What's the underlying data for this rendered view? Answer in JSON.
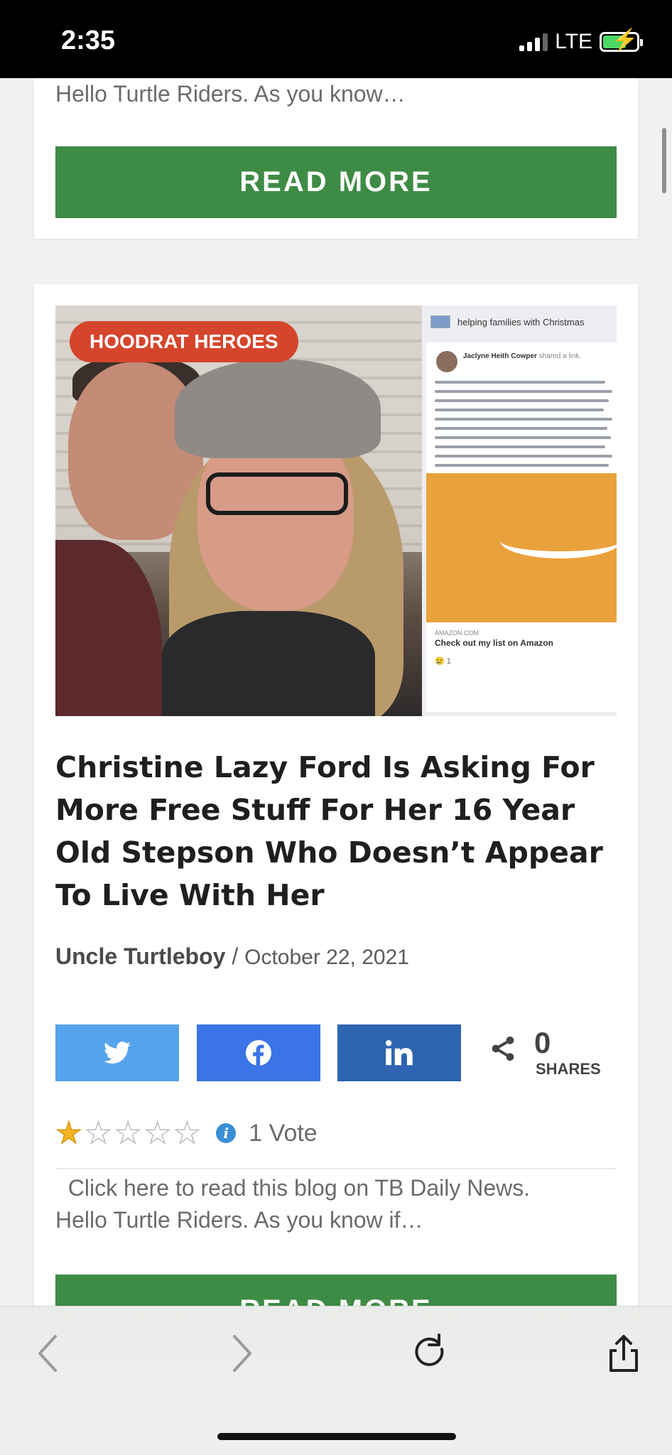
{
  "status_bar": {
    "time": "2:35",
    "network": "LTE"
  },
  "previous_card": {
    "excerpt": "Hello Turtle Riders. As you know…",
    "read_more_label": "READ MORE"
  },
  "article": {
    "category": "HOODRAT HEROES",
    "title": "Christine Lazy Ford Is Asking For More Free Stuff For Her 16 Year Old Stepson Who Doesn’t Appear To Live With Her",
    "author": "Uncle Turtleboy",
    "separator": " / ",
    "date": "October 22, 2021",
    "image": {
      "screenshot_header": "helping families with Christmas",
      "poster_name": "Jaclyne Heith Cowper",
      "poster_action": "shared a link.",
      "link_domain": "AMAZON.COM",
      "link_title": "Check out my list on Amazon",
      "reaction_count": "1"
    },
    "share": {
      "count": "0",
      "label": "SHARES",
      "buttons": [
        "twitter",
        "facebook",
        "linkedin"
      ]
    },
    "rating": {
      "stars_total": 5,
      "stars_filled": 1,
      "votes_text": "1 Vote"
    },
    "excerpt_line1": "  Click here to read this blog on TB Daily News.",
    "excerpt_line2": "Hello Turtle Riders. As you know if…",
    "read_more_label": "READ MORE"
  },
  "icons": {
    "back": "chevron-left-icon",
    "forward": "chevron-right-icon",
    "reload": "reload-icon",
    "share": "share-icon"
  },
  "colors": {
    "read_more": "#3e8b45",
    "category": "#d5452c",
    "twitter": "#55a3ed",
    "facebook": "#3b74e6",
    "linkedin": "#2e64b1"
  }
}
